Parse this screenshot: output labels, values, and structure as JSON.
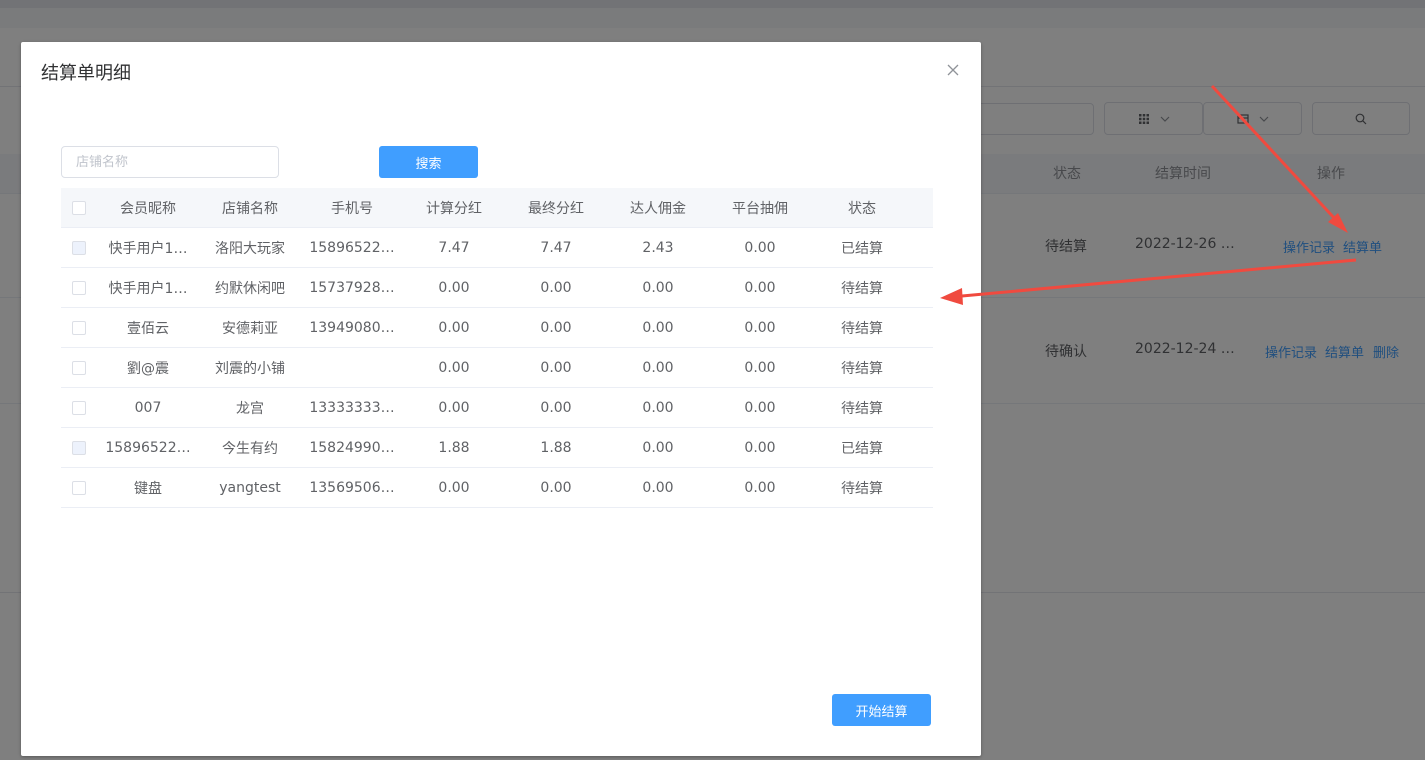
{
  "background": {
    "table_headers": {
      "status": "状态",
      "settle_time": "结算时间",
      "action": "操作"
    },
    "rows": [
      {
        "status": "待结算",
        "settle_time": "2022-12-26 …",
        "actions": [
          "操作记录",
          "结算单"
        ]
      },
      {
        "status": "待确认",
        "settle_time": "2022-12-24 …",
        "actions": [
          "操作记录",
          "结算单",
          "删除"
        ]
      }
    ]
  },
  "dialog": {
    "title": "结算单明细",
    "search": {
      "placeholder": "店铺名称",
      "value": "",
      "button_label": "搜索"
    },
    "table": {
      "headers": [
        "会员昵称",
        "店铺名称",
        "手机号",
        "计算分红",
        "最终分红",
        "达人佣金",
        "平台抽佣",
        "状态"
      ],
      "rows": [
        {
          "checkbox_disabled": true,
          "cells": [
            "快手用户1…",
            "洛阳大玩家",
            "15896522…",
            "7.47",
            "7.47",
            "2.43",
            "0.00",
            "已结算"
          ]
        },
        {
          "checkbox_disabled": false,
          "cells": [
            "快手用户1…",
            "约默休闲吧",
            "15737928…",
            "0.00",
            "0.00",
            "0.00",
            "0.00",
            "待结算"
          ]
        },
        {
          "checkbox_disabled": false,
          "cells": [
            "壹佰云",
            "安德莉亚",
            "13949080…",
            "0.00",
            "0.00",
            "0.00",
            "0.00",
            "待结算"
          ]
        },
        {
          "checkbox_disabled": false,
          "cells": [
            "劉@震",
            "刘震的小铺",
            "",
            "0.00",
            "0.00",
            "0.00",
            "0.00",
            "待结算"
          ]
        },
        {
          "checkbox_disabled": false,
          "cells": [
            "007",
            "龙宫",
            "13333333…",
            "0.00",
            "0.00",
            "0.00",
            "0.00",
            "待结算"
          ]
        },
        {
          "checkbox_disabled": true,
          "cells": [
            "15896522…",
            "今生有约",
            "15824990…",
            "1.88",
            "1.88",
            "0.00",
            "0.00",
            "已结算"
          ]
        },
        {
          "checkbox_disabled": false,
          "cells": [
            "键盘",
            "yangtest",
            "13569506…",
            "0.00",
            "0.00",
            "0.00",
            "0.00",
            "待结算"
          ]
        }
      ]
    },
    "start_button_label": "开始结算"
  },
  "colors": {
    "primary": "#409eff",
    "annotation_arrow": "#f04a3f"
  }
}
